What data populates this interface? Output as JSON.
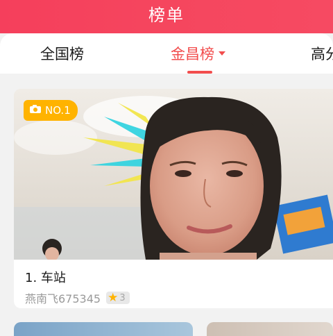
{
  "header": {
    "title": "榜单"
  },
  "tabs": [
    {
      "label": "全国榜",
      "active": false
    },
    {
      "label": "金昌榜",
      "active": true,
      "has_dropdown": true
    },
    {
      "label": "高分",
      "active": false
    }
  ],
  "colors": {
    "accent": "#f24d4d",
    "header": "#f5465e",
    "badge": "#ffb300"
  },
  "cards": [
    {
      "rank_badge": "NO.1",
      "title": "1. 车站",
      "author": "燕南飞675345",
      "level": "3",
      "image": "portrait photo"
    }
  ]
}
